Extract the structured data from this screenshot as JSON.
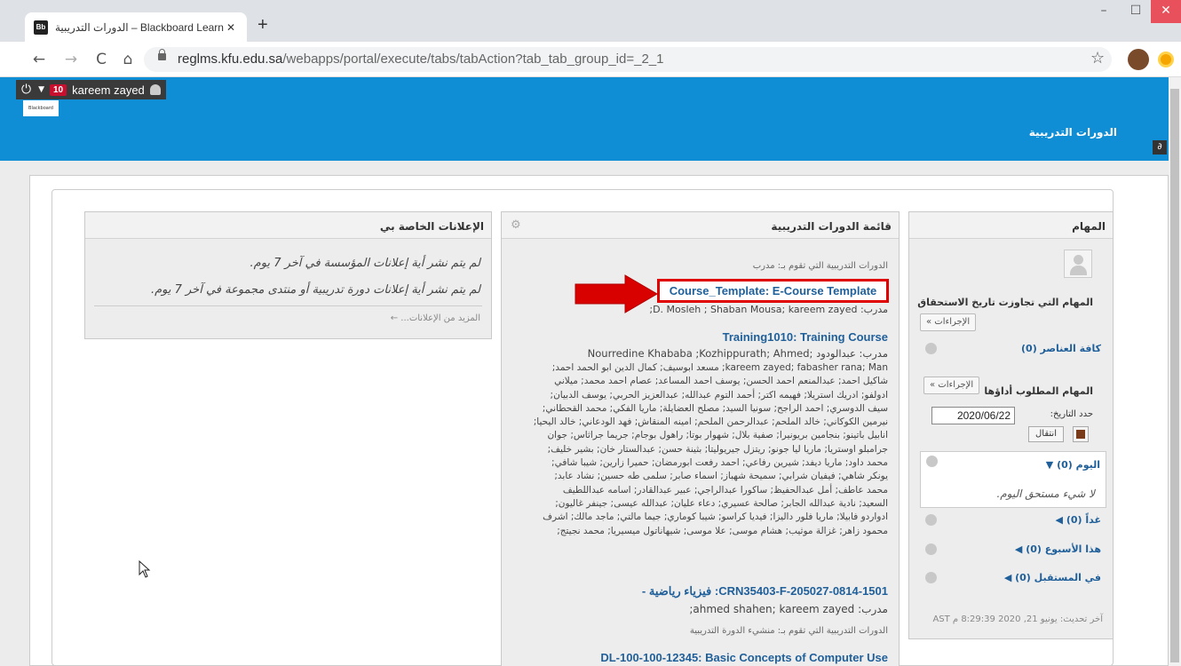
{
  "browser": {
    "tab_title": "الدورات التدريبية – Blackboard Learn",
    "tab_favicon": "Bb",
    "close_tab": "✕",
    "new_tab": "+",
    "url_host": "reglms.kfu.edu.sa",
    "url_path": "/webapps/portal/execute/tabs/tabAction?tab_tab_group_id=_2_1",
    "back": "←",
    "forward": "→",
    "reload": "C",
    "home": "⌂",
    "star": "☆",
    "win_min": "–",
    "win_max": "☐",
    "win_close": "✕"
  },
  "header": {
    "notification_count": "10",
    "user_name": "kareem zayed",
    "logo_text": "Blackboard",
    "tab_title": "الدورات التدريبية",
    "brand_color": "#0f8ed6"
  },
  "announcements": {
    "title": "الإعلانات الخاصة بي",
    "line1": "لم يتم نشر أية إعلانات المؤسسة في آخر 7 يوم.",
    "line2": "لم يتم نشر أية إعلانات دورة تدريبية أو منتدى مجموعة في آخر 7 يوم.",
    "more": "المزيد من الإعلانات... ←"
  },
  "courses": {
    "title": "قائمة الدورات التدريبية",
    "role_instructor": "الدورات التدريبية التي تقوم بـ: مدرب",
    "role_builder": "الدورات التدريبية التي تقوم بـ: منشيء الدورة التدريبية",
    "items": [
      {
        "name": "Course_Template: E-Course Template",
        "instructors": "مدرب: D. Mosleh ; Shaban Mousa; kareem zayed;"
      },
      {
        "name": "Training1010: Training Course",
        "instructors_line1": "مدرب: عبدالودود ;Nourredine Khababa ;Kozhippurath; Ahmed",
        "instructors_rest": "kareem zayed; fabasher rana; Man; مسعد ابوسيف; كمال الدين ابو الحمد احمد; شاكيل احمد; عبدالمنعم احمد الحسن; يوسف احمد المساعد; عصام احمد محمد; ميلاني ادولفو; ادريك استريلا; فهيمه اكتر; أحمد التوم عبدالله; عبدالعزيز الحربي; يوسف الدبيان; سيف الدوسري; احمد الراجح; سونيا السيد; مصلح العضايلة; ماريا الفكي; محمد القحطاني; نيرمين الكوكاني; خالد الملحم; عبدالرحمن الملحم; امينه المنقاش; فهد الودعاني; خالد اليحيا; انابيل باتينو; بنجامين بريونيرا; صفية بلال; شهوار بوتا; راهول بوجام; جريما جراثاس; جوان جرامبلو اوستريا; ماريا ليا جونو; ريتزل جيريوليتا; بثينة حسن; عبدالستار خان; بشير خليف; محمد داود; ماريا ديفد; شيرين رفاعي; احمد رفعت ابورمضان; حميرا زارين; شيبا شافي; يونكر شاهي; فيفيان شرابي; سميحة شهباز; اسماء صابر; سلمى طه حسين; نشاد عابد; محمد عاطف; أمل عبدالحفيظ; ساكورا عبدالراجي; عبير عبدالقادر; اسامه عبداللطيف السعيد; نادية عبدالله الجابر; صالحة عسيري; دعاء عليان; عبدالله عيسى; جينفر غاليون; ادواردو فابيلا; ماريا فلور داليزا; فيديا كراسو; شيبا كوماري; جيما مالتي; ماجد مالك; اشرف محمود زاهر; غزالة موثيب; هشام موسى; علا موسى; شيهاناتول ميسيريا; محمد نجيتج;"
      },
      {
        "name": "CRN35403-F-205027-0814-1501: فيزياء رياضية -",
        "instructors": "مدرب: ahmed shahen; kareem zayed;"
      },
      {
        "name": "DL-100-100-12345: Basic Concepts of Computer Use"
      }
    ]
  },
  "tasks": {
    "title": "المهام",
    "overdue_heading": "المهام التي تجاوزت تاريخ الاستحقاق",
    "actions": "الإجراءات »",
    "all_items": "كافة العناصر (0)",
    "due_heading": "المهام المطلوب أداؤها",
    "date_label": "حدد التاريخ:",
    "date_value": "2020/06/22",
    "go": "انتقال",
    "today": "اليوم (0)",
    "nothing_due": "لا شيء مستحق اليوم.",
    "tomorrow": "غداً (0)",
    "this_week": "هذا الأسبوع (0)",
    "future": "في المستقبل (0)",
    "last_updated": "آخر تحديث: يونيو 21, 2020 8:29:39 م AST"
  }
}
